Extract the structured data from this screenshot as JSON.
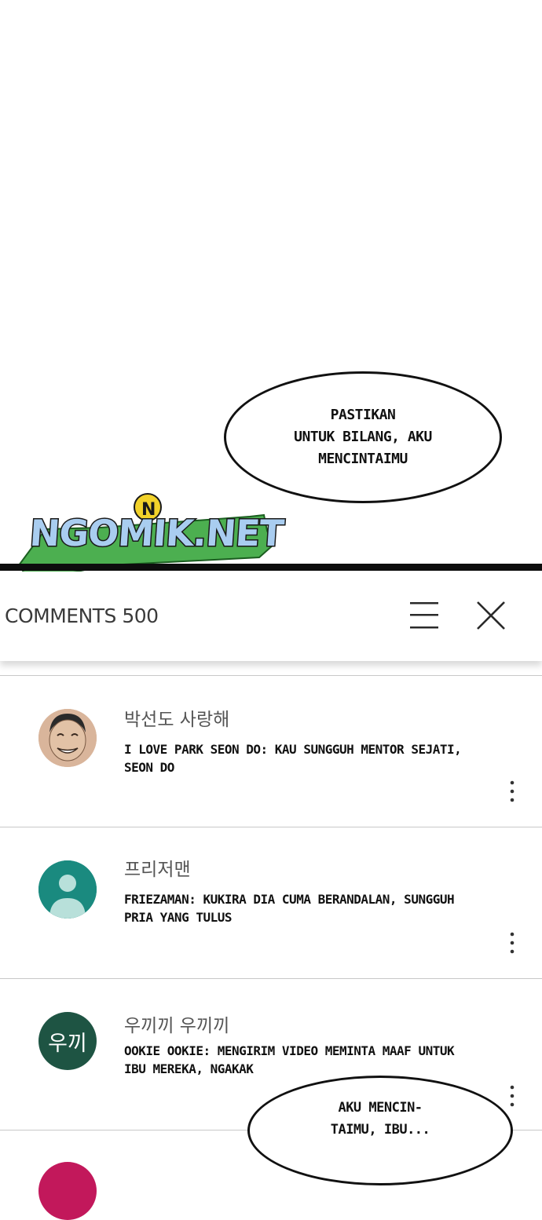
{
  "speech_bubbles": {
    "top": "PASTIKAN\nUNTUK BILANG, AKU\nMENCINTAIMU",
    "bottom": "AKU MENCIN-\nTAIMU, IBU..."
  },
  "watermark": {
    "logo_text": "NGOMIK.NET",
    "colors": {
      "fill": "#a9cdf0",
      "outline": "#1a1a1a",
      "banner": "#4caf50",
      "badge": "#f2d22a"
    }
  },
  "comments_header": {
    "title": "COMMENTS 500",
    "menu_icon": "hamburger-menu-icon",
    "close_icon": "close-icon"
  },
  "comments": [
    {
      "author": "박선도 사랑해",
      "text": "I LOVE PARK SEON DO: KAU SUNGGUH MENTOR SEJATI, SEON DO",
      "avatar": "face-avatar",
      "avatar_color": "#d9b59b"
    },
    {
      "author": "프리저맨",
      "text": "FRIEZAMAN: KUKIRA DIA CUMA BERANDALAN, SUNGGUH PRIA YANG TULUS",
      "avatar": "default-user-avatar",
      "avatar_color": "#1a8a7f"
    },
    {
      "author": "우끼끼 우끼끼",
      "text": "OOKIE OOKIE: MENGIRIM VIDEO MEMINTA MAAF UNTUK IBU MEREKA, NGAKAK",
      "avatar_initials": "우끼",
      "avatar_color": "#1e5443"
    },
    {
      "author": "",
      "text": "",
      "avatar_color": "#c2185b"
    }
  ]
}
